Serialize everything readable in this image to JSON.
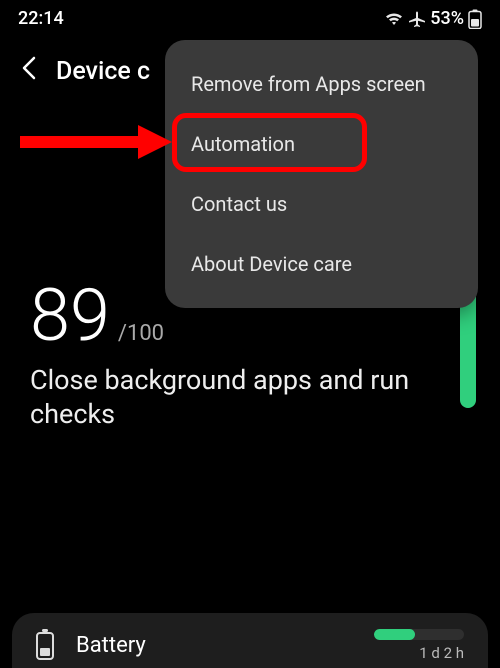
{
  "status": {
    "time": "22:14",
    "battery_pct": "53%"
  },
  "header": {
    "title": "Device c"
  },
  "menu": {
    "items": [
      {
        "label": "Remove from Apps screen"
      },
      {
        "label": "Automation"
      },
      {
        "label": "Contact us"
      },
      {
        "label": "About Device care"
      }
    ]
  },
  "score": {
    "value": "89",
    "max": "/100",
    "summary": "Close background apps and run checks"
  },
  "battery_card": {
    "title": "Battery",
    "time_remaining": "1 d 2 h"
  }
}
